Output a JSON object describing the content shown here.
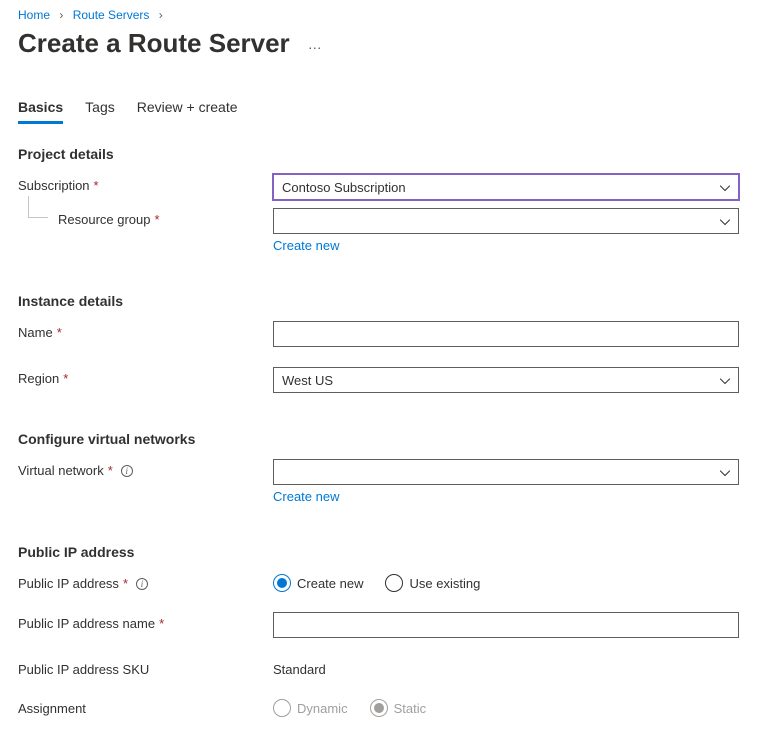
{
  "breadcrumb": {
    "home": "Home",
    "route_servers": "Route Servers"
  },
  "page_title": "Create a Route Server",
  "tabs": {
    "basics": "Basics",
    "tags": "Tags",
    "review": "Review + create"
  },
  "sections": {
    "project_details": "Project details",
    "instance_details": "Instance details",
    "configure_vnet": "Configure virtual networks",
    "public_ip": "Public IP address"
  },
  "labels": {
    "subscription": "Subscription",
    "resource_group": "Resource group",
    "name": "Name",
    "region": "Region",
    "virtual_network": "Virtual network",
    "public_ip_address": "Public IP address",
    "public_ip_name": "Public IP address name",
    "public_ip_sku": "Public IP address SKU",
    "assignment": "Assignment"
  },
  "values": {
    "subscription": "Contoso Subscription",
    "resource_group": "",
    "name": "",
    "region": "West US",
    "virtual_network": "",
    "public_ip_name": "",
    "public_ip_sku": "Standard"
  },
  "links": {
    "create_new": "Create new"
  },
  "radios": {
    "create_new": "Create new",
    "use_existing": "Use existing",
    "dynamic": "Dynamic",
    "static": "Static"
  }
}
